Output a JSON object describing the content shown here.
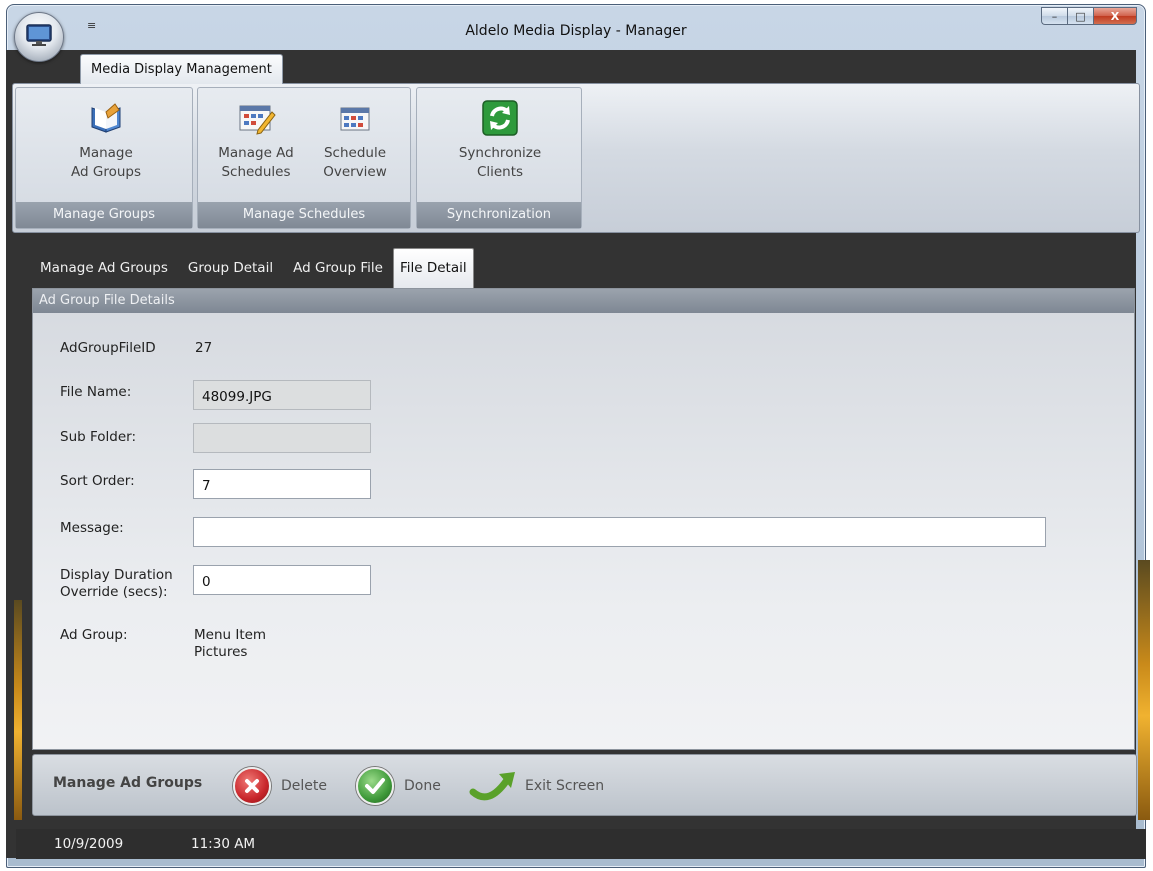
{
  "window": {
    "title": "Aldelo Media Display - Manager",
    "qat_symbol": "≡",
    "minimize_glyph": "–",
    "maximize_glyph": "□",
    "close_glyph": "X"
  },
  "ribbon": {
    "tab_label": "Media Display Management",
    "groups": [
      {
        "label": "Manage Groups",
        "buttons": [
          {
            "label": "Manage\nAd Groups",
            "icon": "book-icon"
          }
        ]
      },
      {
        "label": "Manage Schedules",
        "buttons": [
          {
            "label": "Manage Ad\nSchedules",
            "icon": "calendar-edit-icon"
          },
          {
            "label": "Schedule\nOverview",
            "icon": "calendar-icon"
          }
        ]
      },
      {
        "label": "Synchronization",
        "buttons": [
          {
            "label": "Synchronize\nClients",
            "icon": "sync-icon"
          }
        ]
      }
    ]
  },
  "tabs": [
    {
      "label": "Manage Ad Groups",
      "active": false
    },
    {
      "label": "Group Detail",
      "active": false
    },
    {
      "label": "Ad Group File",
      "active": false
    },
    {
      "label": "File Detail",
      "active": true
    }
  ],
  "panel": {
    "header": "Ad Group File Details",
    "fields": {
      "id_label": "AdGroupFileID",
      "id_value": "27",
      "file_name_label": "File Name:",
      "file_name_value": "48099.JPG",
      "sub_folder_label": "Sub Folder:",
      "sub_folder_value": "",
      "sort_order_label": "Sort Order:",
      "sort_order_value": "7",
      "message_label": "Message:",
      "message_value": "",
      "duration_label_1": "Display Duration",
      "duration_label_2": "Override (secs):",
      "duration_value": "0",
      "ad_group_label": "Ad Group:",
      "ad_group_value_1": "Menu Item",
      "ad_group_value_2": "Pictures"
    }
  },
  "actionbar": {
    "title": "Manage Ad Groups",
    "delete_label": "Delete",
    "done_label": "Done",
    "exit_label": "Exit Screen"
  },
  "status": {
    "date": "10/9/2009",
    "time": "11:30 AM"
  },
  "colors": {
    "delete": "#c8262b",
    "done": "#3f9a3a",
    "exit": "#5aa12a",
    "sync": "#2e9a3c"
  }
}
